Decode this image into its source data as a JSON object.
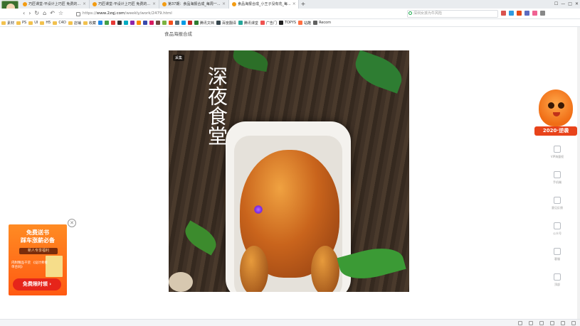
{
  "browser": {
    "tabs": [
      {
        "label": "巧匠课堂-平设计上巧匠 免费的..."
      },
      {
        "label": "巧匠课堂-平设计上巧匠 免费的..."
      },
      {
        "label": "第37期：食品海报合成_每周一..."
      },
      {
        "label": "食品海报合成_小王子没有花_每..."
      }
    ],
    "new_tab": "+",
    "window_controls": [
      "☐",
      "—",
      "□",
      "✕"
    ],
    "url_prefix": "https://",
    "url_host": "www.2zqj.com",
    "url_path": "/weekly/work/2479.html",
    "search_placeholder": "深圳女孩为牛风险",
    "bookmarks": [
      "素材",
      "PS",
      "UI",
      "H5",
      "C4D",
      "店铺",
      "收藏",
      "腾讯文档",
      "百度翻译",
      "腾讯课堂",
      "广告门",
      "TOPYS",
      "站酷",
      "Recom"
    ]
  },
  "page": {
    "title": "食品海报合成",
    "hero": {
      "badge": "采集",
      "calligraphy": "深夜食堂"
    }
  },
  "ad": {
    "title_line1": "免费送书",
    "title_line2": "踩车涨薪必备",
    "ribbon": "新人专享福利",
    "sub": "内附精品干货 《设计师接单合同》",
    "button": "免费限时领 ›",
    "close": "✕"
  },
  "mascot": {
    "banner": "2020·逆袭"
  },
  "sidebar": [
    {
      "label": "VIP海量权"
    },
    {
      "label": "手机端"
    },
    {
      "label": "意见反馈"
    },
    {
      "label": "公众号"
    },
    {
      "label": "客服"
    },
    {
      "label": "顶部"
    }
  ],
  "colors": {
    "accent": "#ff6a13",
    "ad_button": "#e6251a",
    "mascot_banner": "#e8431a"
  }
}
